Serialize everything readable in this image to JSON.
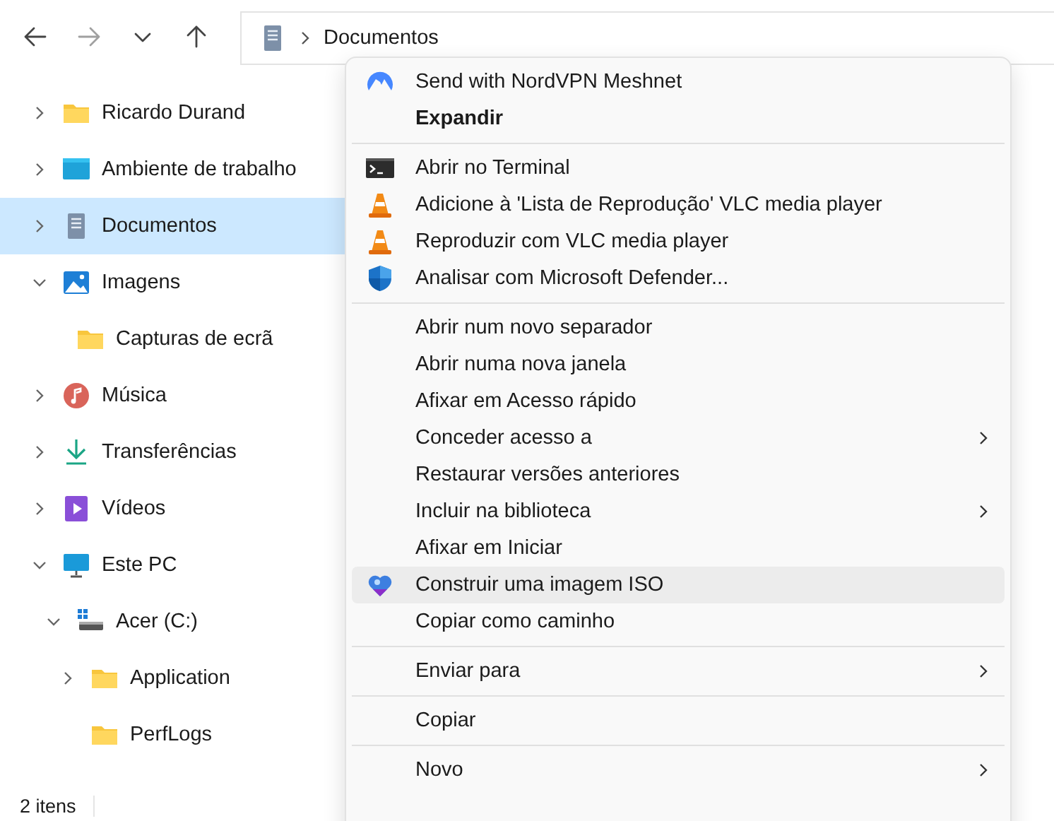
{
  "toolbar": {
    "nav": [
      {
        "kind": "back",
        "disabled": false
      },
      {
        "kind": "forward",
        "disabled": true
      },
      {
        "kind": "recent",
        "disabled": false
      },
      {
        "kind": "up",
        "disabled": false
      }
    ],
    "address": {
      "kind": "documents",
      "segments": [
        "Documentos"
      ]
    }
  },
  "sidebar": {
    "items": [
      {
        "label": "Ricardo Durand",
        "kind": "folder",
        "expandable": true,
        "expanded": false,
        "selected": false
      },
      {
        "label": "Ambiente de trabalho",
        "kind": "desktop",
        "expandable": true,
        "expanded": false,
        "selected": false
      },
      {
        "label": "Documentos",
        "kind": "documents",
        "expandable": true,
        "expanded": false,
        "selected": true
      },
      {
        "label": "Imagens",
        "kind": "pictures",
        "expandable": true,
        "expanded": true,
        "selected": false,
        "children": [
          {
            "label": "Capturas de ecrã",
            "kind": "folder",
            "expandable": false,
            "selected": false
          }
        ]
      },
      {
        "label": "Música",
        "kind": "music",
        "expandable": true,
        "expanded": false,
        "selected": false
      },
      {
        "label": "Transferências",
        "kind": "downloads",
        "expandable": true,
        "expanded": false,
        "selected": false
      },
      {
        "label": "Vídeos",
        "kind": "videos",
        "expandable": true,
        "expanded": false,
        "selected": false
      },
      {
        "label": "Este PC",
        "kind": "pc",
        "expandable": true,
        "expanded": true,
        "selected": false,
        "children": [
          {
            "label": "Acer (C:)",
            "kind": "drive",
            "expandable": true,
            "expanded": true,
            "selected": false,
            "children": [
              {
                "label": "Application",
                "kind": "folder",
                "expandable": true,
                "expanded": false,
                "selected": false
              },
              {
                "label": "PerfLogs",
                "kind": "folder",
                "expandable": false,
                "selected": false
              }
            ]
          }
        ]
      }
    ]
  },
  "status_bar": {
    "text": "2 itens"
  },
  "context_menu": {
    "groups": [
      {
        "items": [
          {
            "label": "Send with NordVPN Meshnet",
            "kind": "vpn",
            "bold": false,
            "submenu": false,
            "highlighted": false
          },
          {
            "label": "Expandir",
            "kind": "plain",
            "bold": true,
            "submenu": false,
            "highlighted": false
          }
        ]
      },
      {
        "items": [
          {
            "label": "Abrir no Terminal",
            "kind": "terminal",
            "bold": false,
            "submenu": false,
            "highlighted": false
          },
          {
            "label": "Adicione à 'Lista de Reprodução' VLC media player",
            "kind": "vlc",
            "bold": false,
            "submenu": false,
            "highlighted": false
          },
          {
            "label": "Reproduzir com VLC media player",
            "kind": "vlc",
            "bold": false,
            "submenu": false,
            "highlighted": false
          },
          {
            "label": "Analisar com Microsoft Defender...",
            "kind": "defender",
            "bold": false,
            "submenu": false,
            "highlighted": false
          }
        ]
      },
      {
        "items": [
          {
            "label": "Abrir num novo separador",
            "kind": "plain",
            "bold": false,
            "submenu": false,
            "highlighted": false
          },
          {
            "label": "Abrir numa nova janela",
            "kind": "plain",
            "bold": false,
            "submenu": false,
            "highlighted": false
          },
          {
            "label": "Afixar em Acesso rápido",
            "kind": "plain",
            "bold": false,
            "submenu": false,
            "highlighted": false
          },
          {
            "label": "Conceder acesso a",
            "kind": "plain",
            "bold": false,
            "submenu": true,
            "highlighted": false
          },
          {
            "label": "Restaurar versões anteriores",
            "kind": "plain",
            "bold": false,
            "submenu": false,
            "highlighted": false
          },
          {
            "label": "Incluir na biblioteca",
            "kind": "plain",
            "bold": false,
            "submenu": true,
            "highlighted": false
          },
          {
            "label": "Afixar em Iniciar",
            "kind": "plain",
            "bold": false,
            "submenu": false,
            "highlighted": false
          },
          {
            "label": "Construir uma imagem ISO",
            "kind": "iso",
            "bold": false,
            "submenu": false,
            "highlighted": true
          },
          {
            "label": "Copiar como caminho",
            "kind": "plain",
            "bold": false,
            "submenu": false,
            "highlighted": false
          }
        ]
      },
      {
        "items": [
          {
            "label": "Enviar para",
            "kind": "plain",
            "bold": false,
            "submenu": true,
            "highlighted": false
          }
        ]
      },
      {
        "items": [
          {
            "label": "Copiar",
            "kind": "plain",
            "bold": false,
            "submenu": false,
            "highlighted": false
          }
        ]
      },
      {
        "items": [
          {
            "label": "Novo",
            "kind": "plain",
            "bold": false,
            "submenu": true,
            "highlighted": false
          }
        ]
      }
    ]
  }
}
